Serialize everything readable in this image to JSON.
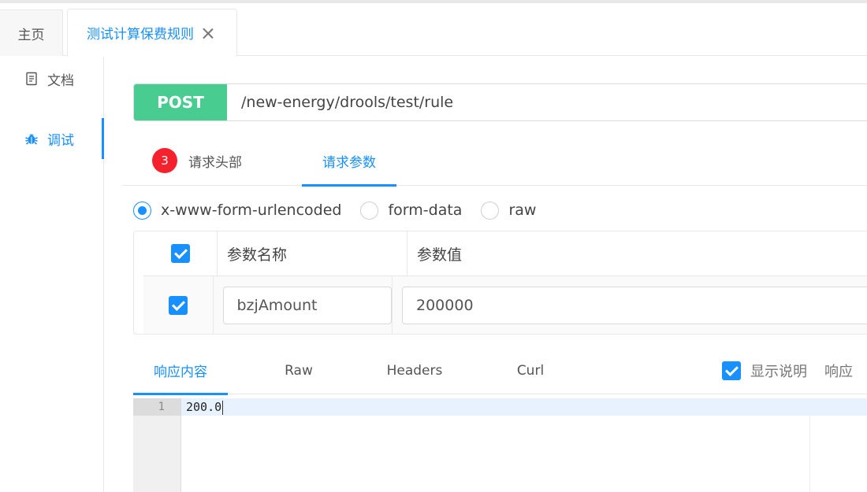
{
  "tabs": {
    "home": "主页",
    "active": "测试计算保费规则"
  },
  "sidebar": {
    "items": [
      {
        "label": "文档",
        "icon": "document-icon"
      },
      {
        "label": "调试",
        "icon": "bug-icon"
      }
    ]
  },
  "request": {
    "method": "POST",
    "url": "/new-energy/drools/test/rule",
    "method_color": "#49cc90"
  },
  "request_tabs": {
    "headers_count": "3",
    "headers_label": "请求头部",
    "params_label": "请求参数"
  },
  "body_types": {
    "options": [
      "x-www-form-urlencoded",
      "form-data",
      "raw"
    ],
    "selected": "x-www-form-urlencoded"
  },
  "params_table": {
    "columns": [
      "参数名称",
      "参数值"
    ],
    "rows": [
      {
        "checked": true,
        "name": "bzjAmount",
        "value": "200000"
      }
    ]
  },
  "response_tabs": {
    "items": [
      "响应内容",
      "Raw",
      "Headers",
      "Curl"
    ],
    "active": "响应内容",
    "show_desc_label": "显示说明",
    "extra_label": "响应"
  },
  "editor": {
    "line_number": "1",
    "line_text": "200.0"
  },
  "colors": {
    "accent": "#1890ff",
    "badge": "#f5222d"
  }
}
